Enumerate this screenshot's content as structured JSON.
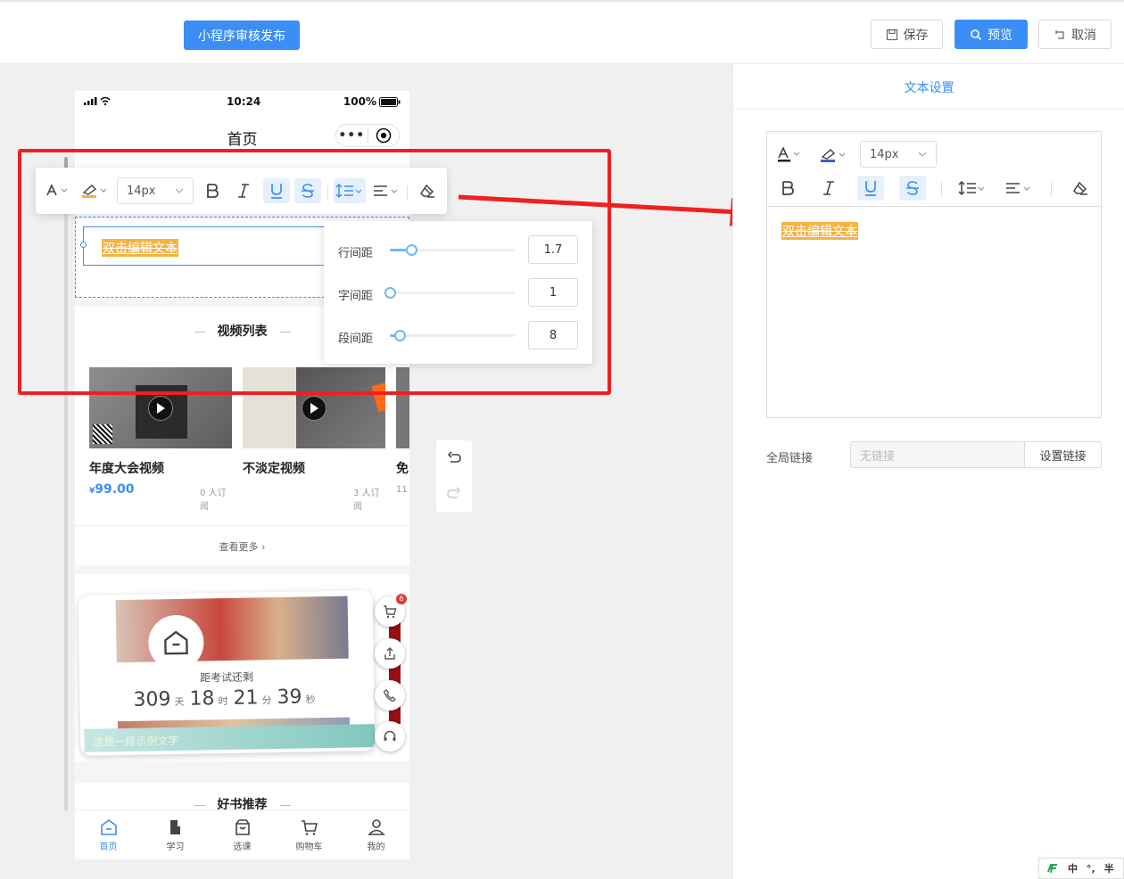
{
  "topbar": {
    "publish_label": "小程序审核发布",
    "save_label": "保存",
    "preview_label": "预览",
    "cancel_label": "取消"
  },
  "phone": {
    "time": "10:24",
    "battery": "100%",
    "nav_title": "首页",
    "capsule_dots": "•••",
    "text_content": "双击编辑文本",
    "video_section_title": "视频列表",
    "videos": [
      {
        "title": "年度大会视频",
        "price_symbol": "¥",
        "price": "99.00",
        "subscribers": "0 人订阅"
      },
      {
        "title": "不淡定视频",
        "subscribers": "3 人订阅"
      },
      {
        "title": "免",
        "subscribers": "11"
      }
    ],
    "view_more": "查看更多",
    "countdown_label": "距考试还剩",
    "countdown": {
      "days": "309",
      "days_unit": "天",
      "hours": "18",
      "hours_unit": "时",
      "minutes": "21",
      "minutes_unit": "分",
      "seconds": "39",
      "seconds_unit": "秒"
    },
    "promo_caption": "这是一段示例文字",
    "cart_badge": "6",
    "books_section_title": "好书推荐",
    "tabs": [
      {
        "label": "首页",
        "active": true
      },
      {
        "label": "学习"
      },
      {
        "label": "选课"
      },
      {
        "label": "购物车"
      },
      {
        "label": "我的"
      }
    ]
  },
  "toolbar": {
    "font_size": "14px"
  },
  "spacing": {
    "rows": [
      {
        "label": "行间距",
        "value": "1.7",
        "fraction": 0.17
      },
      {
        "label": "字间距",
        "value": "1",
        "fraction": 0.0
      },
      {
        "label": "段间距",
        "value": "8",
        "fraction": 0.08
      }
    ]
  },
  "panel": {
    "title": "文本设置",
    "font_size": "14px",
    "content": "双击编辑文本",
    "global_link_label": "全局链接",
    "link_placeholder": "无链接",
    "set_link_label": "设置链接"
  },
  "ime": {
    "lang": "中",
    "punct": "°,",
    "width": "半"
  },
  "colors": {
    "accent": "#3a8ef6",
    "highlight": "#f4b342",
    "annotation_red": "#f02020"
  }
}
